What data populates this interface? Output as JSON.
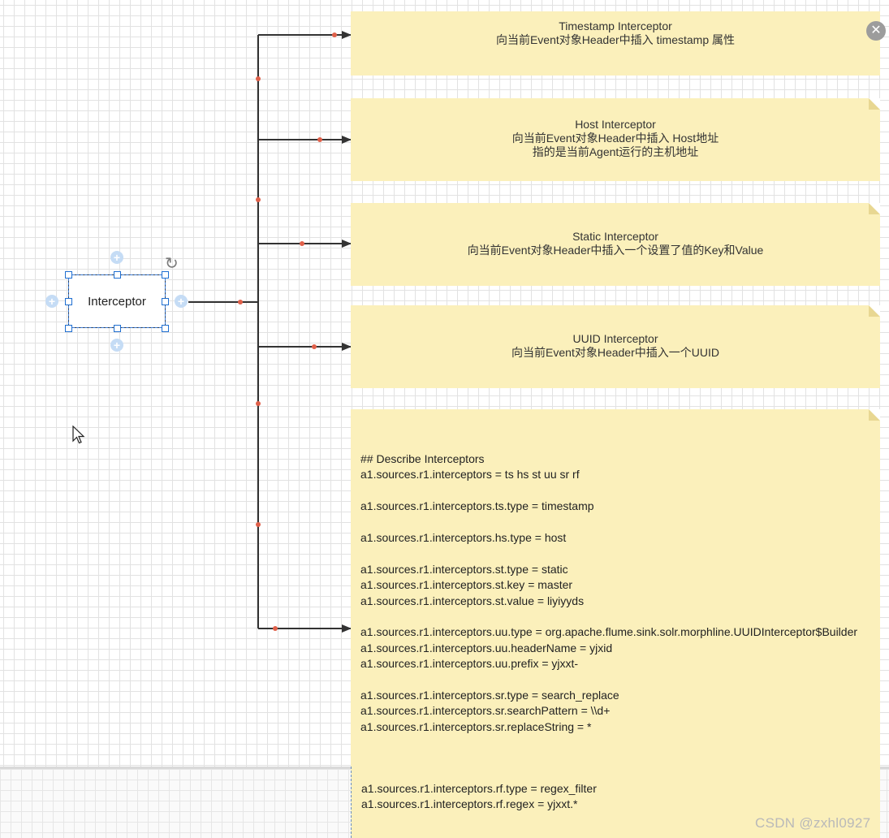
{
  "canvas": {
    "source_node": {
      "label": "Interceptor"
    },
    "notes": [
      {
        "lines": [
          "Timestamp Interceptor",
          "向当前Event对象Header中插入 timestamp 属性"
        ]
      },
      {
        "lines": [
          "Host Interceptor",
          "向当前Event对象Header中插入 Host地址",
          "指的是当前Agent运行的主机地址"
        ]
      },
      {
        "lines": [
          "Static Interceptor",
          "向当前Event对象Header中插入一个设置了值的Key和Value"
        ]
      },
      {
        "lines": [
          "UUID Interceptor",
          "向当前Event对象Header中插入一个UUID"
        ]
      }
    ],
    "config_note": {
      "lines": [
        "## Describe Interceptors",
        "a1.sources.r1.interceptors = ts hs st uu sr rf",
        "",
        "a1.sources.r1.interceptors.ts.type = timestamp",
        "",
        "a1.sources.r1.interceptors.hs.type = host",
        "",
        "a1.sources.r1.interceptors.st.type = static",
        "a1.sources.r1.interceptors.st.key = master",
        "a1.sources.r1.interceptors.st.value = liyiyyds",
        "",
        "a1.sources.r1.interceptors.uu.type = org.apache.flume.sink.solr.morphline.UUIDInterceptor$Builder",
        "a1.sources.r1.interceptors.uu.headerName = yjxid",
        "a1.sources.r1.interceptors.uu.prefix = yjxxt-",
        "",
        "a1.sources.r1.interceptors.sr.type = search_replace",
        "a1.sources.r1.interceptors.sr.searchPattern = \\\\d+",
        "a1.sources.r1.interceptors.sr.replaceString = *"
      ],
      "continued_lines": [
        "a1.sources.r1.interceptors.rf.type = regex_filter",
        "a1.sources.r1.interceptors.rf.regex = yjxxt.*"
      ]
    }
  },
  "icons": {
    "close": "close-icon",
    "rotate": "rotate-icon",
    "cursor": "mouse-pointer-icon",
    "connect": "plus-connect-icon"
  },
  "colors": {
    "note_fill": "#fbf0bb",
    "edge": "#333333",
    "edge_dot": "#e0604a",
    "selection": "#1f6fd1"
  },
  "watermark": "CSDN @zxhl0927"
}
